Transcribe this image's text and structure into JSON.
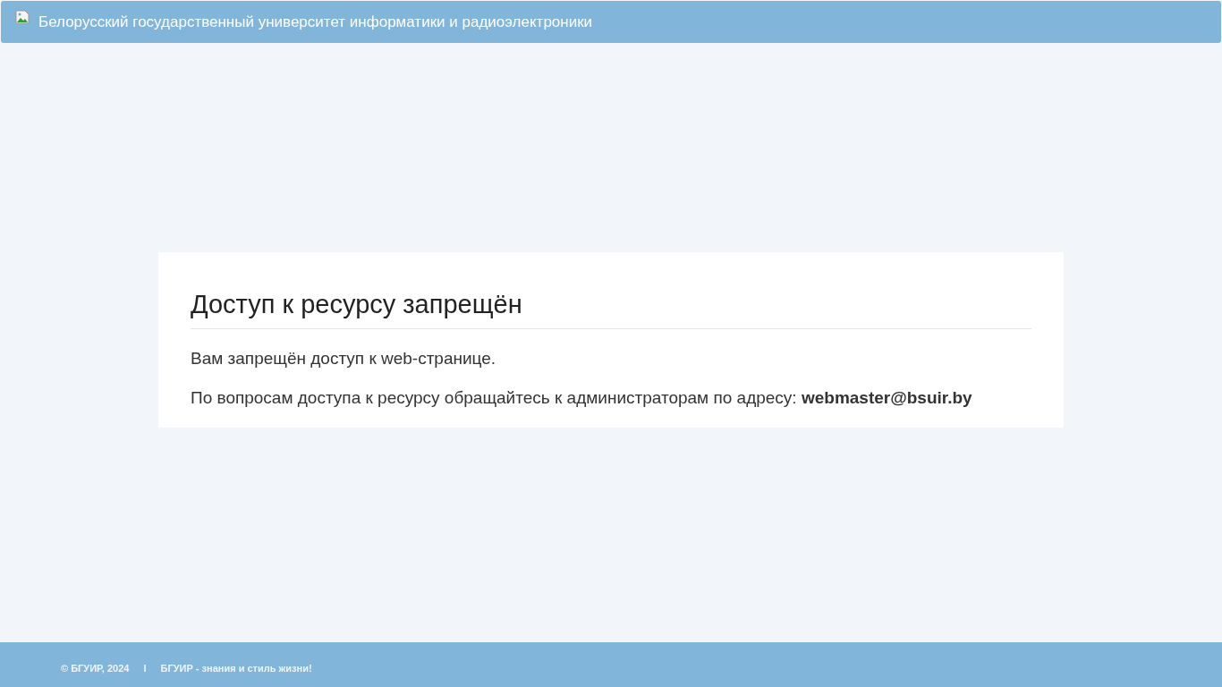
{
  "header": {
    "title": "Белорусский государственный университет информатики и радиоэлектроники"
  },
  "card": {
    "heading": "Доступ к ресурсу запрещён",
    "paragraphs": [
      "Вам запрещён доступ к web-странице.",
      "По вопросам доступа к ресурсу обращайтесь к администраторам по адресу: **webmaster@bsuir.by**"
    ]
  },
  "footer": {
    "copyright": "© БГУИР, 2024",
    "separator": "I",
    "slogan": "БГУИР - знания и стиль жизни!"
  }
}
